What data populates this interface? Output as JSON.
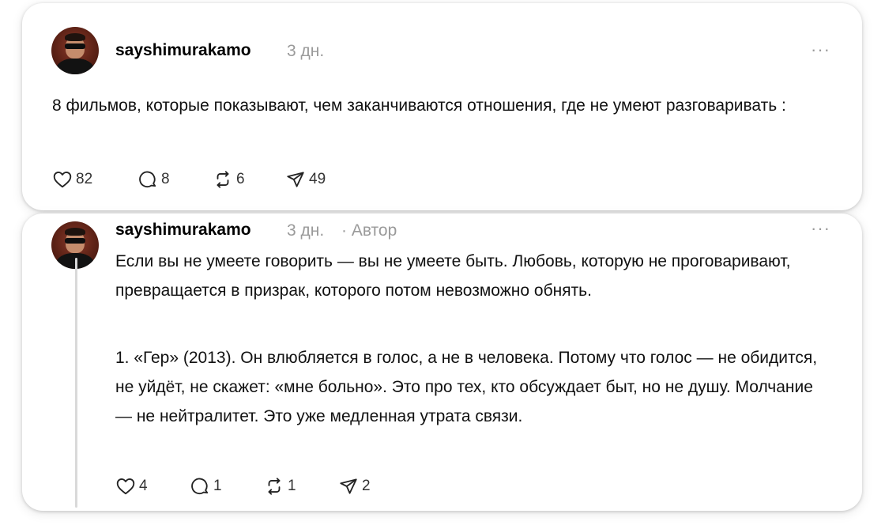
{
  "posts": [
    {
      "username": "sayshimurakamo",
      "time": "3 дн.",
      "more_label": "···",
      "text": "8 фильмов, которые показывают, чем заканчиваются отношения, где не умеют разговаривать :",
      "counts": {
        "likes": "82",
        "replies": "8",
        "reposts": "6",
        "shares": "49"
      }
    },
    {
      "username": "sayshimurakamo",
      "time": "3 дн.",
      "author_tag": "· Автор",
      "more_label": "···",
      "text1": "Если вы не умеете говорить — вы не умеете быть. Любовь, которую не проговаривают, превращается в призрак, которого потом невозможно обнять.",
      "text2": "1. «Гер» (2013). Он влюбляется в голос, а не в человека. Потому что голос — не обидится, не уйдёт, не скажет: «мне больно». Это про тех, кто обсуждает быт, но не душу. Молчание — не нейтралитет. Это уже медленная утрата связи.",
      "counts": {
        "likes": "4",
        "replies": "1",
        "reposts": "1",
        "shares": "2"
      }
    }
  ],
  "icons": {
    "like": "heart-icon",
    "reply": "speech-bubble-icon",
    "repost": "repost-arrows-icon",
    "share": "paper-plane-icon",
    "more": "more-options-icon"
  },
  "colors": {
    "muted": "#9a9a9a",
    "text": "#111111",
    "thread_line": "#d9d9d9"
  }
}
